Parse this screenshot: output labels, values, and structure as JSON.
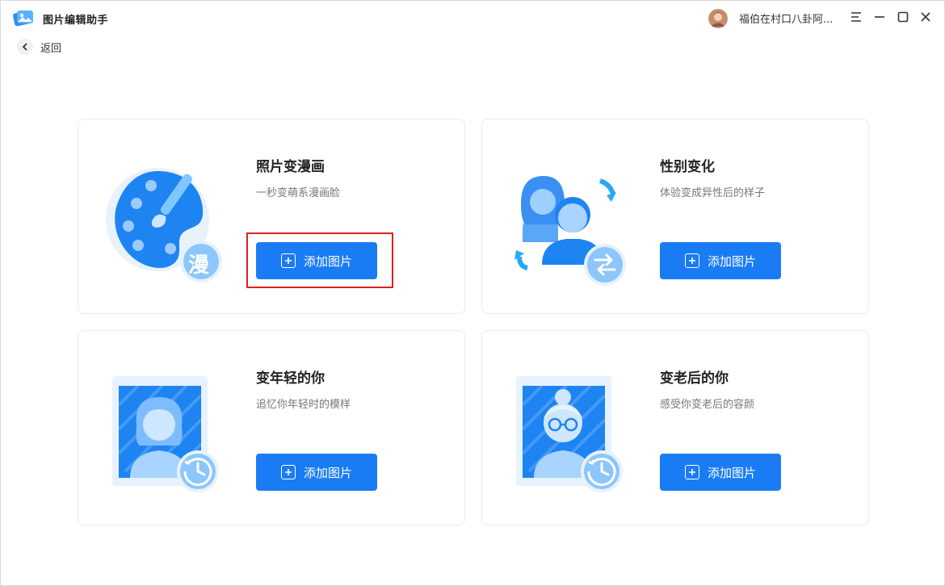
{
  "app": {
    "title": "图片编辑助手"
  },
  "user": {
    "name": "福伯在村口八卦阿..."
  },
  "nav": {
    "back_label": "返回"
  },
  "cards": [
    {
      "title": "照片变漫画",
      "subtitle": "一秒变萌系漫画脸",
      "button_label": "添加图片",
      "badge_text": "漫"
    },
    {
      "title": "性别变化",
      "subtitle": "体验变成异性后的样子",
      "button_label": "添加图片"
    },
    {
      "title": "变年轻的你",
      "subtitle": "追忆你年轻时的模样",
      "button_label": "添加图片"
    },
    {
      "title": "变老后的你",
      "subtitle": "感受你变老后的容颜",
      "button_label": "添加图片"
    }
  ],
  "colors": {
    "accent": "#1a7cf5",
    "highlight": "#e02020"
  }
}
